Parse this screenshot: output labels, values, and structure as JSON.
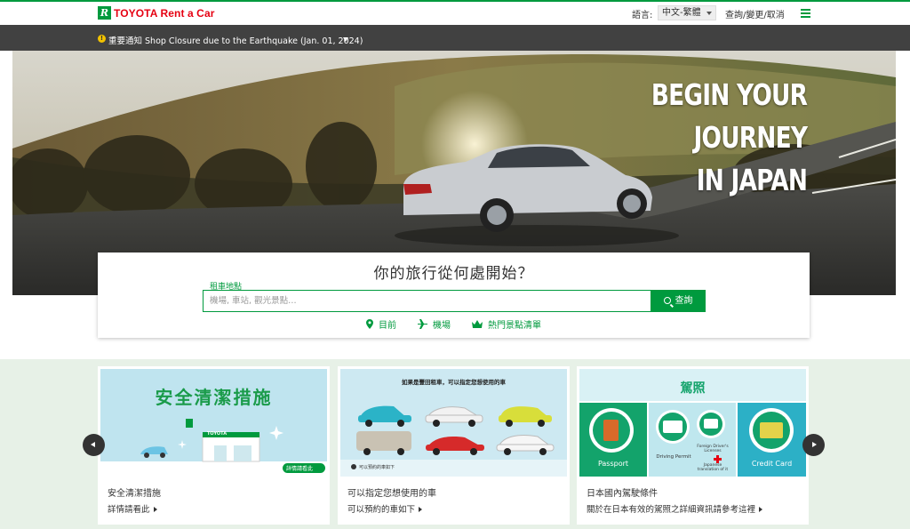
{
  "header": {
    "brand": "TOYOTA Rent a Car",
    "language_label": "語言:",
    "language_selected": "中文-繁體",
    "query_link": "查詢/變更/取消"
  },
  "notice": {
    "text": "重要通知 Shop Closure due to the Earthquake (Jan. 01, 2024)"
  },
  "hero": {
    "line1": "BEGIN YOUR",
    "line2": "JOURNEY",
    "line3": "IN JAPAN"
  },
  "search": {
    "heading": "你的旅行從何處開始？",
    "pickup_label": "租車地點",
    "input_value": "",
    "placeholder": "機場, 車站, 觀光景點…",
    "button_label": "查詢",
    "quick_links": [
      "目前",
      "機場",
      "熱門景點清單"
    ]
  },
  "cards": [
    {
      "banner_title": "安全清潔措施",
      "banner_badge": "詳情請看此",
      "banner_store_sign": "TOYOTA",
      "title": "安全清潔措施",
      "link": "詳情請看此"
    },
    {
      "banner_title": "如果是豐田租車，可以指定您想使用的車",
      "banner_note": "可以預約的車如下",
      "title": "可以指定您想使用的車",
      "link": "可以預約的車如下"
    },
    {
      "banner_title": "駕照",
      "banner_items": [
        "Passport",
        "Driving Permit",
        "Foreign Driver's Licenses",
        "Japanese translation of it",
        "Credit Card"
      ],
      "title": "日本國內駕駛條件",
      "link": "關於在日本有效的駕照之詳細資訊請參考這裡"
    }
  ],
  "colors": {
    "brand_green": "#009a3e",
    "brand_red": "#e60012",
    "notice_bar": "#414141",
    "band": "#e7f1e7"
  }
}
